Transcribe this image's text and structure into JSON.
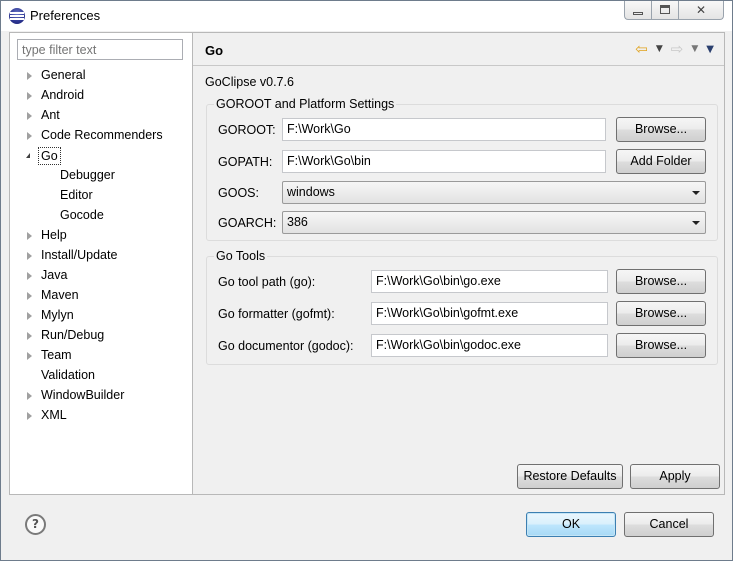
{
  "window": {
    "title": "Preferences"
  },
  "filter": {
    "placeholder": "type filter text"
  },
  "tree": [
    {
      "label": "General"
    },
    {
      "label": "Android"
    },
    {
      "label": "Ant"
    },
    {
      "label": "Code Recommenders"
    },
    {
      "label": "Go"
    },
    {
      "label": "Debugger"
    },
    {
      "label": "Editor"
    },
    {
      "label": "Gocode"
    },
    {
      "label": "Help"
    },
    {
      "label": "Install/Update"
    },
    {
      "label": "Java"
    },
    {
      "label": "Maven"
    },
    {
      "label": "Mylyn"
    },
    {
      "label": "Run/Debug"
    },
    {
      "label": "Team"
    },
    {
      "label": "Validation"
    },
    {
      "label": "WindowBuilder"
    },
    {
      "label": "XML"
    }
  ],
  "page": {
    "title": "Go",
    "version": "GoClipse v0.7.6"
  },
  "goroot_group": {
    "title": "GOROOT and Platform Settings",
    "goroot_label": "GOROOT:",
    "goroot_value": "F:\\Work\\Go",
    "goroot_button": "Browse...",
    "gopath_label": "GOPATH:",
    "gopath_value": "F:\\Work\\Go\\bin",
    "gopath_button": "Add Folder",
    "goos_label": "GOOS:",
    "goos_value": "windows",
    "goarch_label": "GOARCH:",
    "goarch_value": "386"
  },
  "tools_group": {
    "title": "Go Tools",
    "go_label": "Go tool path (go):",
    "go_value": "F:\\Work\\Go\\bin\\go.exe",
    "go_button": "Browse...",
    "gofmt_label": "Go formatter (gofmt):",
    "gofmt_value": "F:\\Work\\Go\\bin\\gofmt.exe",
    "gofmt_button": "Browse...",
    "godoc_label": "Go documentor (godoc):",
    "godoc_value": "F:\\Work\\Go\\bin\\godoc.exe",
    "godoc_button": "Browse..."
  },
  "buttons": {
    "restore_defaults": "Restore Defaults",
    "apply": "Apply",
    "ok": "OK",
    "cancel": "Cancel"
  },
  "icons": {
    "help": "?",
    "back_arrow": "⇦",
    "forward_arrow": "⇨",
    "dropdown": "▼",
    "menu": "▼"
  }
}
